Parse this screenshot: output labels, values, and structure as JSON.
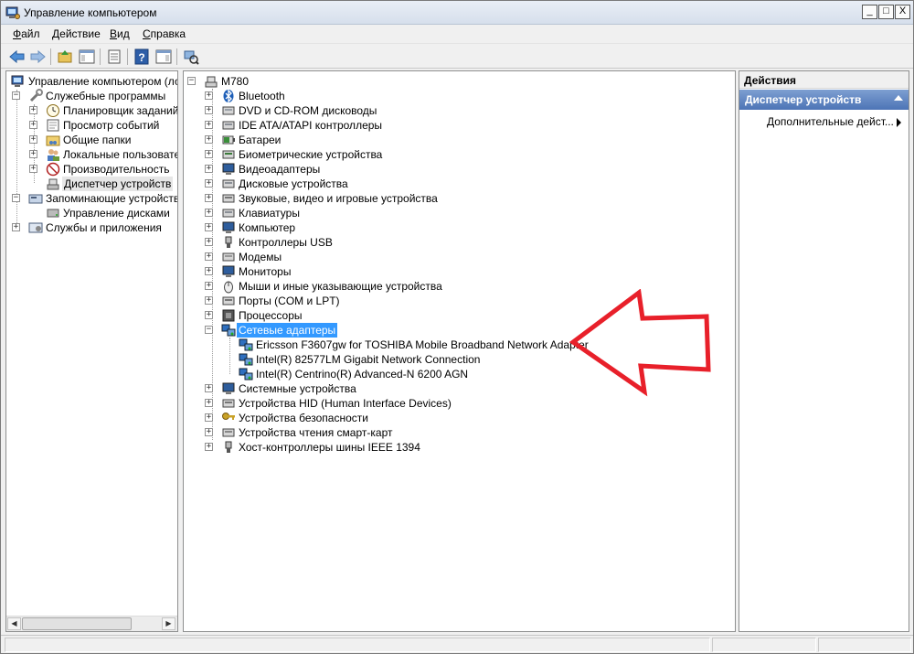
{
  "window": {
    "title": "Управление компьютером",
    "minimize": "_",
    "maximize": "□",
    "close": "X"
  },
  "menu": [
    {
      "label": "Файл",
      "accel": "Ф",
      "rest": "айл"
    },
    {
      "label": "Действие",
      "accel": "Д",
      "rest": "ействие"
    },
    {
      "label": "Вид",
      "accel": "В",
      "rest": "ид"
    },
    {
      "label": "Справка",
      "accel": "С",
      "rest": "правка"
    }
  ],
  "toolbar": [
    "back-arrow-icon",
    "forward-arrow-icon",
    "up-folder-icon",
    "show-hide-tree-icon",
    "properties-icon",
    "help-icon",
    "show-hide-action-icon",
    "scan-hardware-icon"
  ],
  "left_tree": {
    "root": "Управление компьютером (лока",
    "system_tools": "Служебные программы",
    "task_scheduler": "Планировщик заданий",
    "event_viewer": "Просмотр событий",
    "shared_folders": "Общие папки",
    "local_users": "Локальные пользовател",
    "performance": "Производительность",
    "device_manager": "Диспетчер устройств",
    "storage": "Запоминающие устройства",
    "disk_management": "Управление дисками",
    "services": "Службы и приложения"
  },
  "device_tree": {
    "computer": "M780",
    "categories": [
      {
        "label": "Bluetooth",
        "icon": "bluetooth-icon"
      },
      {
        "label": "DVD и CD-ROM дисководы",
        "icon": "dvd-drive-icon"
      },
      {
        "label": "IDE ATA/ATAPI контроллеры",
        "icon": "ide-controller-icon"
      },
      {
        "label": "Батареи",
        "icon": "battery-icon"
      },
      {
        "label": "Биометрические устройства",
        "icon": "biometric-icon"
      },
      {
        "label": "Видеоадаптеры",
        "icon": "display-adapter-icon"
      },
      {
        "label": "Дисковые устройства",
        "icon": "disk-drive-icon"
      },
      {
        "label": "Звуковые, видео и игровые устройства",
        "icon": "sound-icon"
      },
      {
        "label": "Клавиатуры",
        "icon": "keyboard-icon"
      },
      {
        "label": "Компьютер",
        "icon": "computer-icon"
      },
      {
        "label": "Контроллеры USB",
        "icon": "usb-icon"
      },
      {
        "label": "Модемы",
        "icon": "modem-icon"
      },
      {
        "label": "Мониторы",
        "icon": "monitor-icon"
      },
      {
        "label": "Мыши и иные указывающие устройства",
        "icon": "mouse-icon"
      },
      {
        "label": "Порты (COM и LPT)",
        "icon": "port-icon"
      },
      {
        "label": "Процессоры",
        "icon": "processor-icon"
      }
    ],
    "network_adapters": "Сетевые адаптеры",
    "network_devices": [
      "Ericsson F3607gw for TOSHIBA Mobile Broadband Network Adapter",
      "Intel(R) 82577LM Gigabit Network Connection",
      "Intel(R) Centrino(R) Advanced-N 6200 AGN"
    ],
    "categories_after": [
      {
        "label": "Системные устройства",
        "icon": "system-devices-icon"
      },
      {
        "label": "Устройства HID (Human Interface Devices)",
        "icon": "hid-icon"
      },
      {
        "label": "Устройства безопасности",
        "icon": "security-key-icon"
      },
      {
        "label": "Устройства чтения смарт-карт",
        "icon": "smart-card-icon"
      },
      {
        "label": "Хост-контроллеры шины IEEE 1394",
        "icon": "ieee1394-icon"
      }
    ]
  },
  "actions": {
    "header": "Действия",
    "section": "Диспетчер устройств",
    "item": "Дополнительные дейст..."
  },
  "colors": {
    "accent": "#3399ff",
    "annotation_arrow": "#e8202a",
    "actions_header": "#5b80be"
  }
}
